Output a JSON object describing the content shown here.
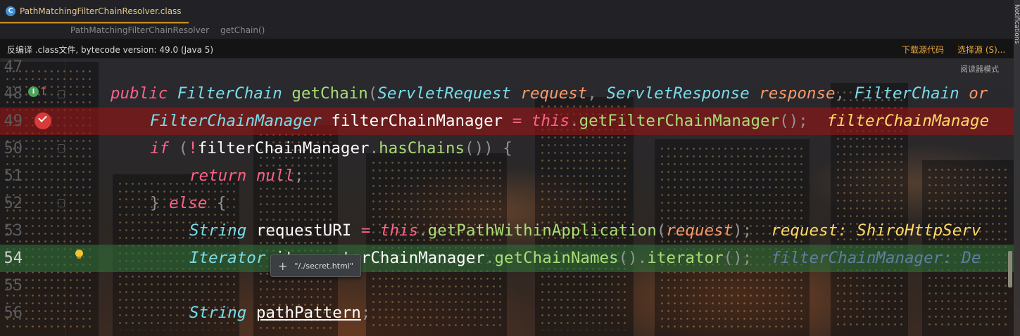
{
  "tab": {
    "icon": "class-file-icon",
    "icon_letter": "C",
    "title": "PathMatchingFilterChainResolver.class"
  },
  "breadcrumb": {
    "class_name": "PathMatchingFilterChainResolver",
    "method": "getChain()"
  },
  "notice": {
    "message": "反编译 .class文件, bytecode version: 49.0 (Java 5)",
    "download_source": "下载源代码",
    "choose_source": "选择源 (S)..."
  },
  "side_panel_label": "Notifications",
  "reader_mode": "阅读器模式",
  "lines": [
    {
      "num": "47"
    },
    {
      "num": "48"
    },
    {
      "num": "49"
    },
    {
      "num": "50"
    },
    {
      "num": "51"
    },
    {
      "num": "52"
    },
    {
      "num": "53"
    },
    {
      "num": "54"
    },
    {
      "num": "55"
    },
    {
      "num": "56"
    }
  ],
  "code": {
    "l48": {
      "kw_public": "public",
      "type_fc": "FilterChain",
      "method": "getChain",
      "t1": "ServletRequest",
      "p1": "request",
      "t2": "ServletResponse",
      "p2": "response",
      "t3": "FilterChain",
      "p3": "or"
    },
    "l49": {
      "type": "FilterChainManager",
      "var": "filterChainManager",
      "kw_this": "this",
      "method": "getFilterChainManager",
      "hint": "filterChainManage"
    },
    "l50": {
      "kw_if": "if",
      "var": "filterChainManager",
      "method": "hasChains"
    },
    "l51": {
      "kw_return": "return",
      "kw_null": "null"
    },
    "l52": {
      "kw_else": "else"
    },
    "l53": {
      "type": "String",
      "var": "requestURI",
      "kw_this": "this",
      "method": "getPathWithinApplication",
      "param": "request",
      "hint": "request: ShiroHttpServ"
    },
    "l54": {
      "type": "Iterator",
      "var_obscured": "it",
      "call_tail": "terChainManager",
      "method1": "getChainNames",
      "method2": "iterator",
      "hint": "filterChainManager: De"
    },
    "l56": {
      "type": "String",
      "var": "pathPattern"
    }
  },
  "tooltip": {
    "value": "\"/./secret.html\""
  },
  "colors": {
    "breakpoint_line": "#8c1616",
    "current_line": "#306e38",
    "tab_underline": "#c68b21",
    "link": "#e8a53a"
  }
}
